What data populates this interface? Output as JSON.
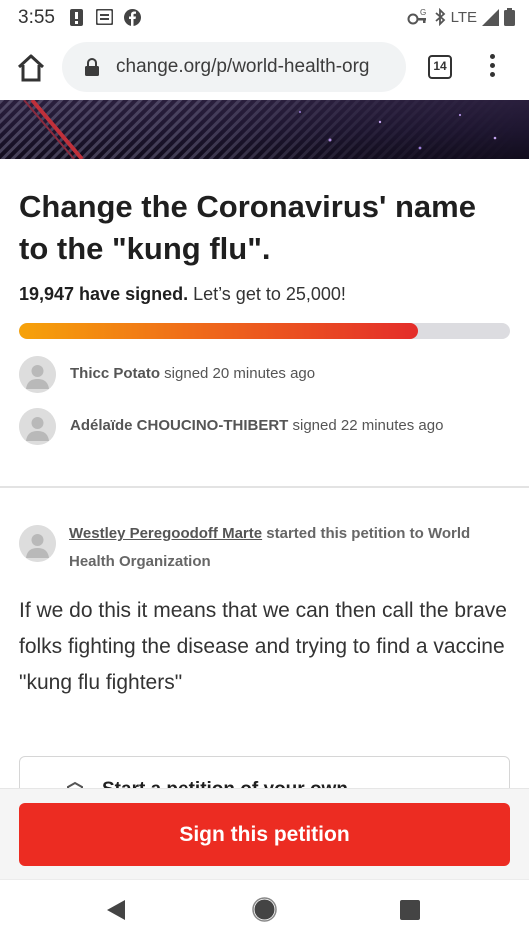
{
  "status_bar": {
    "time": "3:55",
    "network": "LTE",
    "icons": [
      "alert-icon",
      "news-icon",
      "facebook-icon",
      "vpn-key-icon",
      "bluetooth-icon",
      "signal-icon",
      "battery-icon"
    ]
  },
  "browser": {
    "url": "change.org/p/world-health-org",
    "tab_count": "14"
  },
  "petition": {
    "title": "Change the Coronavirus' name to the \"kung flu\".",
    "signature_count_text": "19,947 have signed.",
    "goal_text": "Let’s get to 25,000!",
    "progress_fraction": 0.812
  },
  "recent_signers": [
    {
      "name": "Thicc Potato",
      "action_text": " signed 20 minutes ago"
    },
    {
      "name": "Adélaïde CHOUCINO-THIBERT",
      "action_text": " signed 22 minutes ago"
    }
  ],
  "starter": {
    "name": "Westley Peregoodoff Marte",
    "action_text": " started this petition to World Health Organization"
  },
  "description": "If we do this it means that we can then call the brave folks fighting the disease and trying to find a vaccine \"kung flu fighters\"",
  "own_petition_card": {
    "label": "Start a petition of your own"
  },
  "cta": {
    "label": "Sign this petition"
  },
  "colors": {
    "cta_red": "#ec2c22",
    "progress_start": "#f6a20a",
    "progress_end": "#e42d2a",
    "progress_track": "#dcdce0"
  }
}
